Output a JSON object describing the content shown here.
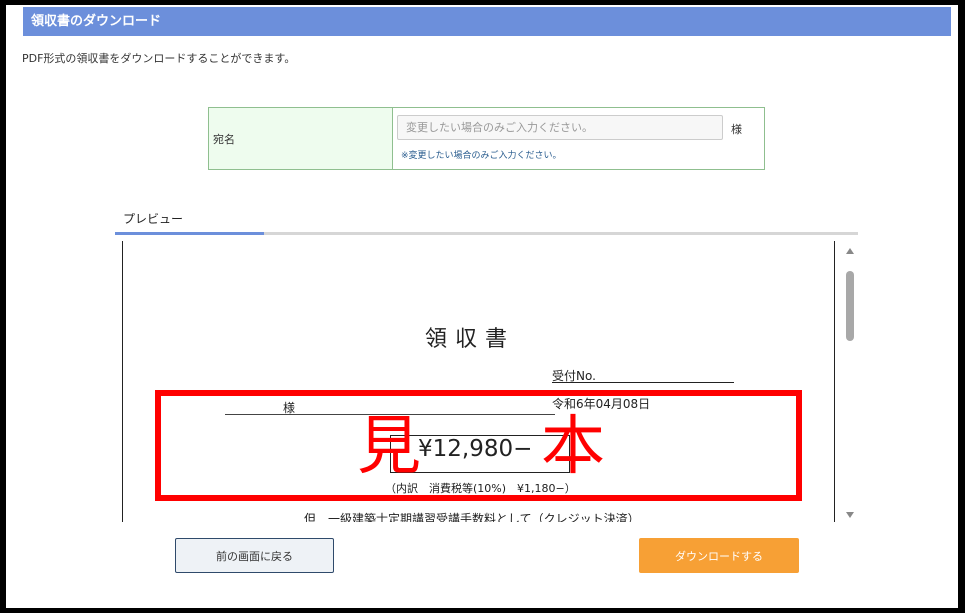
{
  "header": {
    "title": "領収書のダウンロード"
  },
  "description": "PDF形式の領収書をダウンロードすることができます。",
  "addressee": {
    "label": "宛名",
    "input_value": "",
    "placeholder": "変更したい場合のみご入力ください。",
    "honorific": "様",
    "note": "※変更したい場合のみご入力ください。"
  },
  "preview": {
    "tab_label": "プレビュー",
    "receipt": {
      "title": "領収書",
      "receipt_number_label": "受付No.",
      "issue_date": "令和6年04月08日",
      "recipient_honorific": "様",
      "amount": "¥12,980−",
      "tax_breakdown": "（内訳　消費税等(10%)　¥1,180−）",
      "purpose": "但　一級建築士定期講習受講手数料として（クレジット決済）"
    },
    "sample_stamp": {
      "char1": "見",
      "char2": "本",
      "color": "#ff0000"
    }
  },
  "buttons": {
    "back_label": "前の画面に戻る",
    "download_label": "ダウンロードする"
  },
  "colors": {
    "header_bg": "#6c8fdb",
    "download_button": "#f7a035",
    "label_cell_bg": "#eefcee"
  }
}
